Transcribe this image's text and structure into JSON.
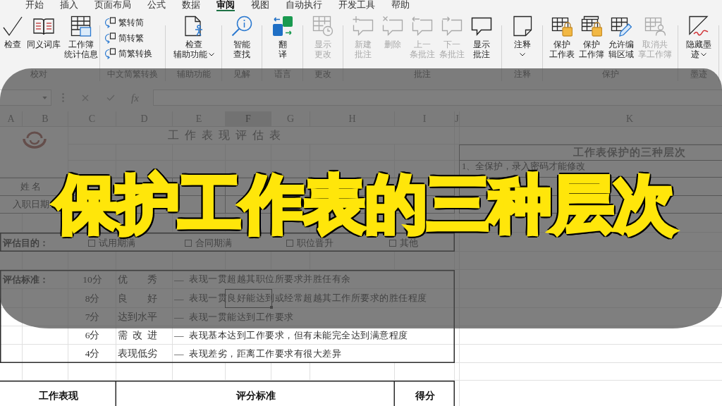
{
  "ribbon_tabs": [
    {
      "label": "开始",
      "selected": false
    },
    {
      "label": "插入",
      "selected": false
    },
    {
      "label": "页面布局",
      "selected": false
    },
    {
      "label": "公式",
      "selected": false
    },
    {
      "label": "数据",
      "selected": false
    },
    {
      "label": "审阅",
      "selected": true
    },
    {
      "label": "视图",
      "selected": false
    },
    {
      "label": "自动执行",
      "selected": false
    },
    {
      "label": "开发工具",
      "selected": false
    },
    {
      "label": "帮助",
      "selected": false
    }
  ],
  "ribbon_groups": [
    {
      "label": "校对",
      "buttons": [
        {
          "kind": "large",
          "lines": [
            "检查"
          ],
          "disabled": false,
          "dropdown": false
        },
        {
          "kind": "large",
          "lines": [
            "同义词库"
          ],
          "disabled": false,
          "dropdown": false
        },
        {
          "kind": "large",
          "lines": [
            "工作簿",
            "统计信息"
          ],
          "disabled": false,
          "dropdown": false
        }
      ]
    },
    {
      "label": "中文简繁转换",
      "buttons": [
        {
          "kind": "small",
          "lines": [
            "繁转简"
          ],
          "disabled": false,
          "dropdown": false
        },
        {
          "kind": "small",
          "lines": [
            "简转繁"
          ],
          "disabled": false,
          "dropdown": false
        },
        {
          "kind": "small",
          "lines": [
            "简繁转换"
          ],
          "disabled": false,
          "dropdown": false
        }
      ]
    },
    {
      "label": "辅助功能",
      "buttons": [
        {
          "kind": "large",
          "lines": [
            "检查",
            "辅助功能"
          ],
          "disabled": false,
          "dropdown": true
        }
      ]
    },
    {
      "label": "见解",
      "buttons": [
        {
          "kind": "large",
          "lines": [
            "智能",
            "查找"
          ],
          "disabled": false,
          "dropdown": false
        }
      ]
    },
    {
      "label": "语言",
      "buttons": [
        {
          "kind": "large",
          "lines": [
            "翻",
            "译"
          ],
          "disabled": false,
          "dropdown": false
        }
      ]
    },
    {
      "label": "更改",
      "buttons": [
        {
          "kind": "large",
          "lines": [
            "显示",
            "更改"
          ],
          "disabled": true,
          "dropdown": false
        }
      ]
    },
    {
      "label": "批注",
      "buttons": [
        {
          "kind": "large",
          "lines": [
            "新建",
            "批注"
          ],
          "disabled": true,
          "dropdown": false
        },
        {
          "kind": "large",
          "lines": [
            "删除"
          ],
          "disabled": true,
          "dropdown": false
        },
        {
          "kind": "large",
          "lines": [
            "上一",
            "条批注"
          ],
          "disabled": true,
          "dropdown": false
        },
        {
          "kind": "large",
          "lines": [
            "下一",
            "条批注"
          ],
          "disabled": true,
          "dropdown": false
        },
        {
          "kind": "large",
          "lines": [
            "显示",
            "批注"
          ],
          "disabled": false,
          "dropdown": false
        }
      ]
    },
    {
      "label": "注释",
      "buttons": [
        {
          "kind": "large",
          "lines": [
            "注释"
          ],
          "disabled": false,
          "dropdown": true
        }
      ]
    },
    {
      "label": "保护",
      "buttons": [
        {
          "kind": "large",
          "lines": [
            "保护",
            "工作表"
          ],
          "disabled": false,
          "dropdown": false
        },
        {
          "kind": "large",
          "lines": [
            "保护",
            "工作簿"
          ],
          "disabled": false,
          "dropdown": false
        },
        {
          "kind": "large",
          "lines": [
            "允许编",
            "辑区域"
          ],
          "disabled": false,
          "dropdown": false
        },
        {
          "kind": "large",
          "lines": [
            "取消共",
            "享工作簿"
          ],
          "disabled": true,
          "dropdown": false
        }
      ]
    },
    {
      "label": "墨迹",
      "buttons": [
        {
          "kind": "large",
          "lines": [
            "隐藏墨",
            "迹"
          ],
          "disabled": false,
          "dropdown": true
        }
      ]
    }
  ],
  "formula_bar": {
    "function_label": "fx"
  },
  "sheet": {
    "columns": [
      {
        "label": "A",
        "selected": false
      },
      {
        "label": "B",
        "selected": false
      },
      {
        "label": "C",
        "selected": false
      },
      {
        "label": "D",
        "selected": false
      },
      {
        "label": "E",
        "selected": false
      },
      {
        "label": "F",
        "selected": true
      },
      {
        "label": "G",
        "selected": false
      },
      {
        "label": "H",
        "selected": false
      },
      {
        "label": "I",
        "selected": false
      },
      {
        "label": "J",
        "selected": false
      },
      {
        "label": "K",
        "selected": false
      }
    ],
    "form_title": "工作表现评估表",
    "info_labels": [
      "姓 名",
      "入职日期"
    ],
    "purpose": {
      "label": "评估目的：",
      "options": [
        {
          "label": "试用期满",
          "checked": false
        },
        {
          "label": "合同期满",
          "checked": false
        },
        {
          "label": "职位晋升",
          "checked": false
        },
        {
          "label": "其他",
          "checked": false
        }
      ]
    },
    "criteria": {
      "label": "评估标准：",
      "rows": [
        {
          "score": "10分",
          "grade": "优秀",
          "dash": "—",
          "description": "表现一贯超越其职位所要求并胜任有余",
          "selected": false
        },
        {
          "score": "8分",
          "grade": "良好",
          "dash": "—",
          "description": "表现一贯良好能达到或经常超越其工作所要求的胜任程度",
          "selected": true
        },
        {
          "score": "7分",
          "grade": "达到水平",
          "dash": "—",
          "description": "表现一贯能达到工作要求",
          "selected": false
        },
        {
          "score": "6分",
          "grade": "需改进",
          "dash": "—",
          "description": "表现基本达到工作要求，但有未能完全达到满意程度",
          "selected": false
        },
        {
          "score": "4分",
          "grade": "表现低劣",
          "dash": "—",
          "description": "表现差劣，距离工作要求有很大差异",
          "selected": false
        }
      ]
    },
    "score_table": {
      "headers": [
        "工作表现",
        "评分标准",
        "得分"
      ]
    },
    "protection_table": {
      "title": "工作表保护的三种层次",
      "rows": [
        "1、全保护，录入密码才能修改"
      ]
    }
  },
  "caption": "保护工作表的三种层次"
}
